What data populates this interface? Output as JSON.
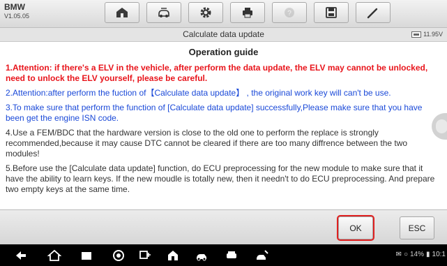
{
  "app": {
    "brand": "BMW",
    "version": "V1.05.05"
  },
  "header": {
    "title": "Calculate data update",
    "battery": "11.95V"
  },
  "guide": {
    "title": "Operation guide",
    "paragraphs": [
      "1.Attention: if there's a ELV in the vehicle, after perform the data update, the ELV may cannot be unlocked, need to unlock the ELV yourself, please be careful.",
      "2.Attention:after perform the fuction of【Calculate data update】 , the original work key will can't be use.",
      "3.To make sure that perform the function of [Calculate data update] successfully,Please make sure that you have been get the engine ISN code.",
      "4.Use a FEM/BDC that the hardware version is close to the old one to perform the replace is strongly recommended,because it may cause DTC cannot be cleared if there are too many diffrence between the two modules!",
      "5.Before use the [Calculate data update] function, do ECU preprocessing for the new module to make sure that it have the ability to learn keys. If the new moudle is totally new, then it needn't to do ECU preprocessing. And prepare two empty keys at the same time."
    ]
  },
  "actions": {
    "ok": "OK",
    "esc": "ESC"
  },
  "statusbar": {
    "battery_pct": "14%",
    "time": "10:1"
  },
  "colors": {
    "warning": "#e8141b",
    "info": "#1a49d8",
    "highlight": "#e02020"
  }
}
